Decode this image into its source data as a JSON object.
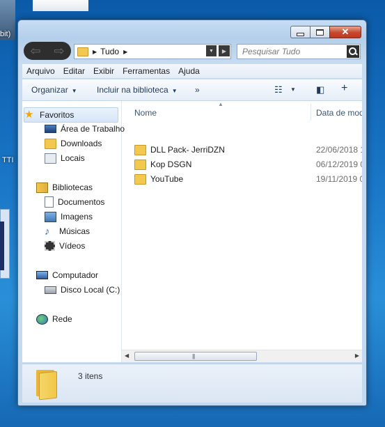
{
  "desktop": {
    "label_top": "bit)",
    "label_side": "TTI"
  },
  "window": {
    "address": {
      "path": [
        "Tudo"
      ]
    },
    "search_placeholder": "Pesquisar Tudo",
    "menu": [
      "Arquivo",
      "Editar",
      "Exibir",
      "Ferramentas",
      "Ajuda"
    ],
    "toolbar": {
      "organize": "Organizar",
      "include": "Incluir na biblioteca",
      "more": "»"
    },
    "nav": {
      "favorites": {
        "label": "Favoritos",
        "items": [
          "Área de Trabalho",
          "Downloads",
          "Locais"
        ]
      },
      "libraries": {
        "label": "Bibliotecas",
        "items": [
          "Documentos",
          "Imagens",
          "Músicas",
          "Vídeos"
        ]
      },
      "computer": {
        "label": "Computador",
        "items": [
          "Disco Local (C:)"
        ]
      },
      "network": {
        "label": "Rede"
      }
    },
    "columns": {
      "name": "Nome",
      "date": "Data de mod"
    },
    "files": [
      {
        "name": "DLL Pack- JerriDZN",
        "date": "22/06/2018 1"
      },
      {
        "name": "Kop DSGN",
        "date": "06/12/2019 0"
      },
      {
        "name": "YouTube",
        "date": "19/11/2019 0"
      }
    ],
    "status": {
      "count": "3 itens"
    }
  }
}
